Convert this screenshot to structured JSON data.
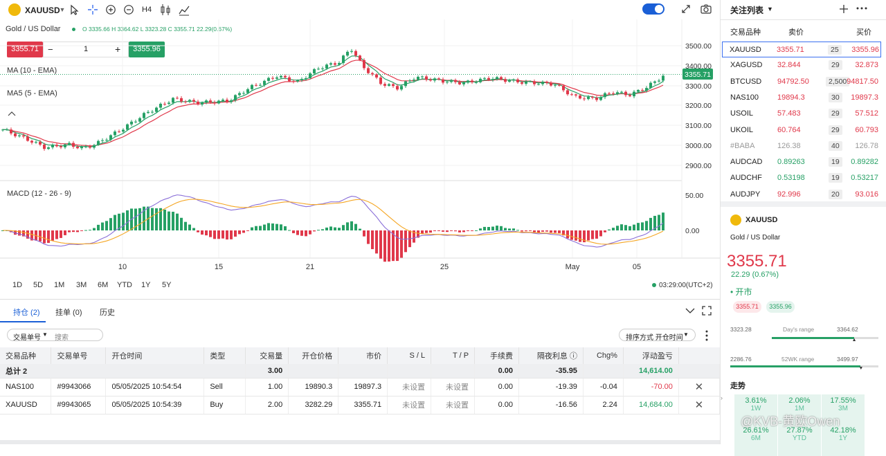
{
  "symbol": {
    "code": "XAUUSD",
    "name": "Gold / US Dollar",
    "timeframe": "H4"
  },
  "legend": {
    "open": "O 3335.66",
    "high": "H 3364.62",
    "low": "L 3323.28",
    "close": "C 3355.71",
    "change": "22.29(0.67%)",
    "ma10": "MA (10 - EMA)",
    "ma5": "MA5 (5 - EMA)",
    "macd": "MACD (12 - 26 - 9)"
  },
  "trade": {
    "sell": "3355.71",
    "qty": "1",
    "buy": "3355.96",
    "minus": "−",
    "plus": "+"
  },
  "price_axis": [
    "3500.00",
    "3400.00",
    "3300.00",
    "3200.00",
    "3100.00",
    "3000.00",
    "2900.00"
  ],
  "current_price": "3355.71",
  "macd_axis": [
    "50.00",
    "0.00"
  ],
  "date_axis": [
    "10",
    "15",
    "21",
    "25",
    "May",
    "05"
  ],
  "timeframes": [
    "1D",
    "5D",
    "1M",
    "3M",
    "6M",
    "YTD",
    "1Y",
    "5Y"
  ],
  "clock": "03:29:00(UTC+2)",
  "colors": {
    "up": "#26a065",
    "down": "#e0384a",
    "ma10": "#e0384a",
    "ma5": "#26a065",
    "macd": "#8a6fd8",
    "signal": "#f5a623",
    "accent": "#1a5fd6"
  },
  "positions": {
    "tabs": [
      "持仓 (2)",
      "挂单 (0)",
      "历史"
    ],
    "filter_label": "交易单号",
    "search_placeholder": "搜索",
    "sort_label": "排序方式 开仓时间",
    "headers": [
      "交易品种",
      "交易单号",
      "开仓时间",
      "类型",
      "交易量",
      "开仓价格",
      "市价",
      "S / L",
      "T / P",
      "手续费",
      "隔夜利息",
      "Chg%",
      "浮动盈亏"
    ],
    "total": {
      "label": "总计 2",
      "volume": "3.00",
      "fee": "0.00",
      "swap": "-35.95",
      "pnl": "14,614.00"
    },
    "rows": [
      {
        "symbol": "NAS100",
        "id": "#9943066",
        "time": "05/05/2025 10:54:54",
        "type": "Sell",
        "volume": "1.00",
        "open": "19890.3",
        "market": "19897.3",
        "sl": "未设置",
        "tp": "未设置",
        "fee": "0.00",
        "swap": "-19.39",
        "chg": "-0.04",
        "pnl": "-70.00"
      },
      {
        "symbol": "XAUUSD",
        "id": "#9943065",
        "time": "05/05/2025 10:54:39",
        "type": "Buy",
        "volume": "2.00",
        "open": "3282.29",
        "market": "3355.71",
        "sl": "未设置",
        "tp": "未设置",
        "fee": "0.00",
        "swap": "-16.56",
        "chg": "2.24",
        "pnl": "14,684.00"
      }
    ]
  },
  "watchlist": {
    "title": "关注列表",
    "col_symbol": "交易品种",
    "col_bid": "卖价",
    "col_ask": "买价",
    "items": [
      {
        "symbol": "XAUUSD",
        "bid": "3355.71",
        "spread": "25",
        "ask": "3355.96",
        "dir": "down"
      },
      {
        "symbol": "XAGUSD",
        "bid": "32.844",
        "spread": "29",
        "ask": "32.873",
        "dir": "down"
      },
      {
        "symbol": "BTCUSD",
        "bid": "94792.50",
        "spread": "2,500",
        "ask": "94817.50",
        "dir": "down"
      },
      {
        "symbol": "NAS100",
        "bid": "19894.3",
        "spread": "30",
        "ask": "19897.3",
        "dir": "down"
      },
      {
        "symbol": "USOIL",
        "bid": "57.483",
        "spread": "29",
        "ask": "57.512",
        "dir": "down"
      },
      {
        "symbol": "UKOIL",
        "bid": "60.764",
        "spread": "29",
        "ask": "60.793",
        "dir": "down"
      },
      {
        "symbol": "#BABA",
        "bid": "126.38",
        "spread": "40",
        "ask": "126.78",
        "dir": "muted"
      },
      {
        "symbol": "AUDCAD",
        "bid": "0.89263",
        "spread": "19",
        "ask": "0.89282",
        "dir": "up"
      },
      {
        "symbol": "AUDCHF",
        "bid": "0.53198",
        "spread": "19",
        "ask": "0.53217",
        "dir": "up"
      },
      {
        "symbol": "AUDJPY",
        "bid": "92.996",
        "spread": "20",
        "ask": "93.016",
        "dir": "down"
      }
    ]
  },
  "detail": {
    "symbol": "XAUUSD",
    "name": "Gold / US Dollar",
    "price": "3355.71",
    "change": "22.29 (0.67%)",
    "status": "开市",
    "bid": "3355.71",
    "ask": "3355.96",
    "day_low": "3323.28",
    "day_label": "Day's range",
    "day_high": "3364.62",
    "day_pos": 0.77,
    "wk_low": "2286.76",
    "wk_label": "52WK range",
    "wk_high": "3499.97",
    "wk_pos": 0.88,
    "trend_label": "走势",
    "perf": [
      {
        "value": "3.61%",
        "label": "1W"
      },
      {
        "value": "2.06%",
        "label": "1M"
      },
      {
        "value": "17.55%",
        "label": "3M"
      },
      {
        "value": "26.61%",
        "label": "6M"
      },
      {
        "value": "27.87%",
        "label": "YTD"
      },
      {
        "value": "42.18%",
        "label": "1Y"
      }
    ]
  },
  "watermark": "@KVB-黄欧Owen"
}
